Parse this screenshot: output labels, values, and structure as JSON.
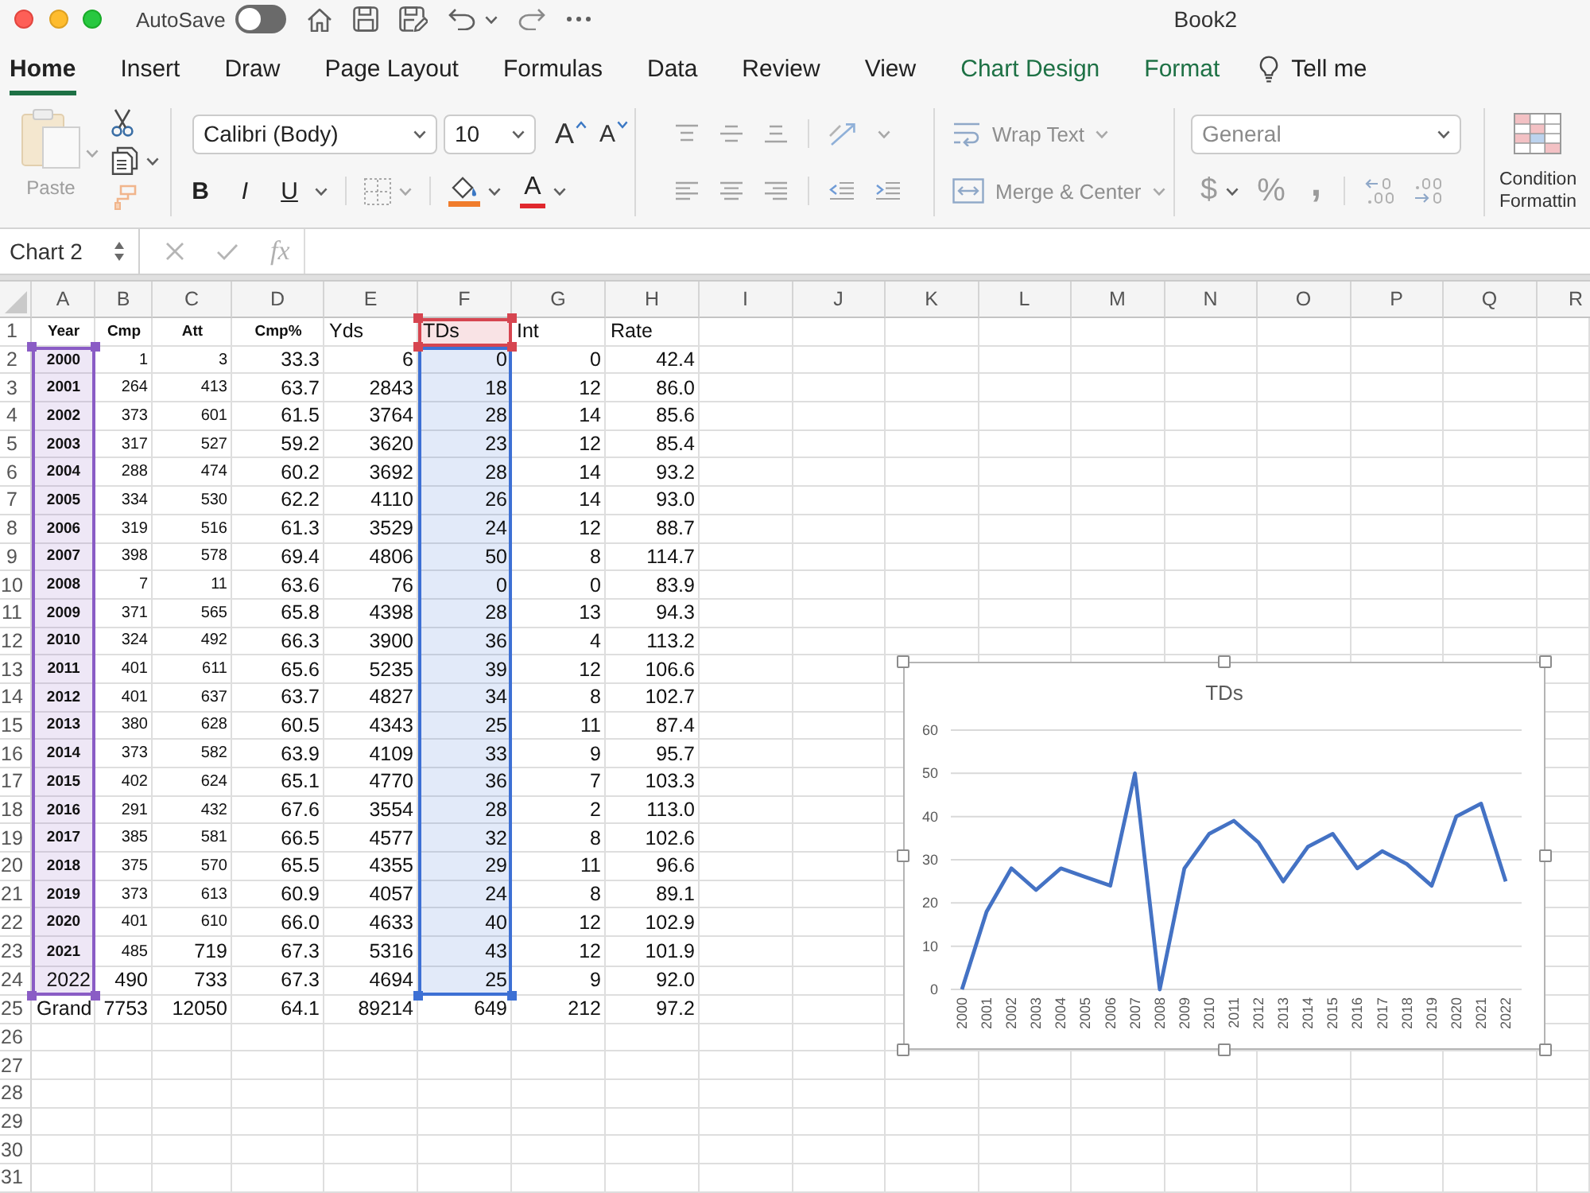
{
  "window": {
    "title": "Book2"
  },
  "title_bar": {
    "autosave": {
      "label": "AutoSave",
      "on": false
    }
  },
  "tabs": [
    {
      "label": "Home",
      "kind": "standard",
      "selected": true
    },
    {
      "label": "Insert",
      "kind": "standard",
      "selected": false
    },
    {
      "label": "Draw",
      "kind": "standard",
      "selected": false
    },
    {
      "label": "Page Layout",
      "kind": "standard",
      "selected": false
    },
    {
      "label": "Formulas",
      "kind": "standard",
      "selected": false
    },
    {
      "label": "Data",
      "kind": "standard",
      "selected": false
    },
    {
      "label": "Review",
      "kind": "standard",
      "selected": false
    },
    {
      "label": "View",
      "kind": "standard",
      "selected": false
    },
    {
      "label": "Chart Design",
      "kind": "contextual",
      "selected": false
    },
    {
      "label": "Format",
      "kind": "contextual",
      "selected": false
    }
  ],
  "tell_me": {
    "label": "Tell me"
  },
  "ribbon": {
    "paste": {
      "label": "Paste",
      "disabled": true
    },
    "font_name": {
      "value": "Calibri (Body)"
    },
    "font_size": {
      "value": "10"
    },
    "size_buttons": [
      {
        "label": "A",
        "kind": "grow"
      },
      {
        "label": "A",
        "kind": "shrink"
      }
    ],
    "style_buttons": [
      {
        "label": "B",
        "kind": "bold"
      },
      {
        "label": "I",
        "kind": "italic"
      },
      {
        "label": "U",
        "kind": "underline"
      }
    ],
    "font_color": {
      "label": "A"
    },
    "wrap_text": {
      "label": "Wrap Text",
      "disabled": true
    },
    "merge_center": {
      "label": "Merge & Center",
      "disabled": true
    },
    "number_format": {
      "value": "General",
      "disabled": true
    },
    "number_buttons": [
      {
        "label": "$",
        "kind": "currency",
        "disabled": true
      },
      {
        "label": "%",
        "kind": "percent",
        "disabled": true
      },
      {
        "label": ",",
        "kind": "comma",
        "disabled": true
      }
    ],
    "conditional_formatting": {
      "lines": [
        "Condition",
        "Formattin"
      ]
    }
  },
  "formula_bar": {
    "name_box": "Chart 2",
    "function_label": "fx"
  },
  "sheet": {
    "columns": [
      "A",
      "B",
      "C",
      "D",
      "E",
      "F",
      "G",
      "H",
      "I",
      "J",
      "K",
      "L",
      "M",
      "N",
      "O",
      "P",
      "Q",
      "R"
    ],
    "rows": [
      {
        "number": "1",
        "kind": "heading",
        "cells": [
          {
            "text": "Year"
          },
          {
            "text": "Cmp"
          },
          {
            "text": "Att"
          },
          {
            "text": "Cmp%"
          },
          {
            "text": "Yds"
          },
          {
            "text": "TDs",
            "color": "#d64550"
          },
          {
            "text": "Int"
          },
          {
            "text": "Rate"
          }
        ]
      },
      {
        "number": "2",
        "kind": "pasted",
        "cells": [
          {
            "text": "2000",
            "color": "#8a5cc5"
          },
          {
            "text": "1"
          },
          {
            "text": "3"
          },
          {
            "text": "33.3"
          },
          {
            "text": "6"
          },
          {
            "text": "0",
            "color": "#3d70d4"
          },
          {
            "text": "0"
          },
          {
            "text": "42.4"
          }
        ]
      },
      {
        "number": "3",
        "kind": "pasted",
        "cells": [
          {
            "text": "2001",
            "color": "#8a5cc5"
          },
          {
            "text": "264"
          },
          {
            "text": "413"
          },
          {
            "text": "63.7"
          },
          {
            "text": "2843"
          },
          {
            "text": "18",
            "color": "#3d70d4"
          },
          {
            "text": "12"
          },
          {
            "text": "86.0"
          }
        ]
      },
      {
        "number": "4",
        "kind": "pasted",
        "cells": [
          {
            "text": "2002",
            "color": "#8a5cc5"
          },
          {
            "text": "373"
          },
          {
            "text": "601"
          },
          {
            "text": "61.5"
          },
          {
            "text": "3764"
          },
          {
            "text": "28",
            "color": "#3d70d4"
          },
          {
            "text": "14"
          },
          {
            "text": "85.6"
          }
        ]
      },
      {
        "number": "5",
        "kind": "pasted",
        "cells": [
          {
            "text": "2003",
            "color": "#8a5cc5"
          },
          {
            "text": "317"
          },
          {
            "text": "527"
          },
          {
            "text": "59.2"
          },
          {
            "text": "3620"
          },
          {
            "text": "23",
            "color": "#3d70d4"
          },
          {
            "text": "12"
          },
          {
            "text": "85.4"
          }
        ]
      },
      {
        "number": "6",
        "kind": "pasted",
        "cells": [
          {
            "text": "2004",
            "color": "#8a5cc5"
          },
          {
            "text": "288"
          },
          {
            "text": "474"
          },
          {
            "text": "60.2"
          },
          {
            "text": "3692"
          },
          {
            "text": "28",
            "color": "#3d70d4"
          },
          {
            "text": "14"
          },
          {
            "text": "93.2"
          }
        ]
      },
      {
        "number": "7",
        "kind": "pasted",
        "cells": [
          {
            "text": "2005",
            "color": "#8a5cc5"
          },
          {
            "text": "334"
          },
          {
            "text": "530"
          },
          {
            "text": "62.2"
          },
          {
            "text": "4110"
          },
          {
            "text": "26",
            "color": "#3d70d4"
          },
          {
            "text": "14"
          },
          {
            "text": "93.0"
          }
        ]
      },
      {
        "number": "8",
        "kind": "pasted",
        "cells": [
          {
            "text": "2006",
            "color": "#8a5cc5"
          },
          {
            "text": "319"
          },
          {
            "text": "516"
          },
          {
            "text": "61.3"
          },
          {
            "text": "3529"
          },
          {
            "text": "24",
            "color": "#3d70d4"
          },
          {
            "text": "12"
          },
          {
            "text": "88.7"
          }
        ]
      },
      {
        "number": "9",
        "kind": "pasted",
        "cells": [
          {
            "text": "2007",
            "color": "#8a5cc5"
          },
          {
            "text": "398"
          },
          {
            "text": "578"
          },
          {
            "text": "69.4"
          },
          {
            "text": "4806"
          },
          {
            "text": "50",
            "color": "#3d70d4"
          },
          {
            "text": "8"
          },
          {
            "text": "114.7"
          }
        ]
      },
      {
        "number": "10",
        "kind": "pasted",
        "cells": [
          {
            "text": "2008",
            "color": "#8a5cc5"
          },
          {
            "text": "7"
          },
          {
            "text": "11"
          },
          {
            "text": "63.6"
          },
          {
            "text": "76"
          },
          {
            "text": "0",
            "color": "#3d70d4"
          },
          {
            "text": "0"
          },
          {
            "text": "83.9"
          }
        ]
      },
      {
        "number": "11",
        "kind": "pasted",
        "cells": [
          {
            "text": "2009",
            "color": "#8a5cc5"
          },
          {
            "text": "371"
          },
          {
            "text": "565"
          },
          {
            "text": "65.8"
          },
          {
            "text": "4398"
          },
          {
            "text": "28",
            "color": "#3d70d4"
          },
          {
            "text": "13"
          },
          {
            "text": "94.3"
          }
        ]
      },
      {
        "number": "12",
        "kind": "pasted",
        "cells": [
          {
            "text": "2010",
            "color": "#8a5cc5"
          },
          {
            "text": "324"
          },
          {
            "text": "492"
          },
          {
            "text": "66.3"
          },
          {
            "text": "3900"
          },
          {
            "text": "36",
            "color": "#3d70d4"
          },
          {
            "text": "4"
          },
          {
            "text": "113.2"
          }
        ]
      },
      {
        "number": "13",
        "kind": "pasted",
        "cells": [
          {
            "text": "2011",
            "color": "#8a5cc5"
          },
          {
            "text": "401"
          },
          {
            "text": "611"
          },
          {
            "text": "65.6"
          },
          {
            "text": "5235"
          },
          {
            "text": "39",
            "color": "#3d70d4"
          },
          {
            "text": "12"
          },
          {
            "text": "106.6"
          }
        ]
      },
      {
        "number": "14",
        "kind": "pasted",
        "cells": [
          {
            "text": "2012",
            "color": "#8a5cc5"
          },
          {
            "text": "401"
          },
          {
            "text": "637"
          },
          {
            "text": "63.7"
          },
          {
            "text": "4827"
          },
          {
            "text": "34",
            "color": "#3d70d4"
          },
          {
            "text": "8"
          },
          {
            "text": "102.7"
          }
        ]
      },
      {
        "number": "15",
        "kind": "pasted",
        "cells": [
          {
            "text": "2013",
            "color": "#8a5cc5"
          },
          {
            "text": "380"
          },
          {
            "text": "628"
          },
          {
            "text": "60.5"
          },
          {
            "text": "4343"
          },
          {
            "text": "25",
            "color": "#3d70d4"
          },
          {
            "text": "11"
          },
          {
            "text": "87.4"
          }
        ]
      },
      {
        "number": "16",
        "kind": "pasted",
        "cells": [
          {
            "text": "2014",
            "color": "#8a5cc5"
          },
          {
            "text": "373"
          },
          {
            "text": "582"
          },
          {
            "text": "63.9"
          },
          {
            "text": "4109"
          },
          {
            "text": "33",
            "color": "#3d70d4"
          },
          {
            "text": "9"
          },
          {
            "text": "95.7"
          }
        ]
      },
      {
        "number": "17",
        "kind": "pasted",
        "cells": [
          {
            "text": "2015",
            "color": "#8a5cc5"
          },
          {
            "text": "402"
          },
          {
            "text": "624"
          },
          {
            "text": "65.1"
          },
          {
            "text": "4770"
          },
          {
            "text": "36",
            "color": "#3d70d4"
          },
          {
            "text": "7"
          },
          {
            "text": "103.3"
          }
        ]
      },
      {
        "number": "18",
        "kind": "pasted",
        "cells": [
          {
            "text": "2016",
            "color": "#8a5cc5"
          },
          {
            "text": "291"
          },
          {
            "text": "432"
          },
          {
            "text": "67.6"
          },
          {
            "text": "3554"
          },
          {
            "text": "28",
            "color": "#3d70d4"
          },
          {
            "text": "2"
          },
          {
            "text": "113.0"
          }
        ]
      },
      {
        "number": "19",
        "kind": "pasted",
        "cells": [
          {
            "text": "2017",
            "color": "#8a5cc5"
          },
          {
            "text": "385"
          },
          {
            "text": "581"
          },
          {
            "text": "66.5"
          },
          {
            "text": "4577"
          },
          {
            "text": "32",
            "color": "#3d70d4"
          },
          {
            "text": "8"
          },
          {
            "text": "102.6"
          }
        ]
      },
      {
        "number": "20",
        "kind": "pasted",
        "cells": [
          {
            "text": "2018",
            "color": "#8a5cc5"
          },
          {
            "text": "375"
          },
          {
            "text": "570"
          },
          {
            "text": "65.5"
          },
          {
            "text": "4355"
          },
          {
            "text": "29",
            "color": "#3d70d4"
          },
          {
            "text": "11"
          },
          {
            "text": "96.6"
          }
        ]
      },
      {
        "number": "21",
        "kind": "pasted",
        "cells": [
          {
            "text": "2019",
            "color": "#8a5cc5"
          },
          {
            "text": "373"
          },
          {
            "text": "613"
          },
          {
            "text": "60.9"
          },
          {
            "text": "4057"
          },
          {
            "text": "24",
            "color": "#3d70d4"
          },
          {
            "text": "8"
          },
          {
            "text": "89.1"
          }
        ]
      },
      {
        "number": "22",
        "kind": "pasted",
        "cells": [
          {
            "text": "2020",
            "color": "#8a5cc5"
          },
          {
            "text": "401"
          },
          {
            "text": "610"
          },
          {
            "text": "66.0"
          },
          {
            "text": "4633"
          },
          {
            "text": "40",
            "color": "#3d70d4"
          },
          {
            "text": "12"
          },
          {
            "text": "102.9"
          }
        ]
      },
      {
        "number": "23",
        "kind": "mixed",
        "cells": [
          {
            "text": "2021",
            "color": "#8a5cc5"
          },
          {
            "text": "485"
          },
          {
            "text": "719"
          },
          {
            "text": "67.3"
          },
          {
            "text": "5316"
          },
          {
            "text": "43",
            "color": "#3d70d4"
          },
          {
            "text": "12"
          },
          {
            "text": "101.9"
          }
        ]
      },
      {
        "number": "24",
        "kind": "plain",
        "cells": [
          {
            "text": "2022",
            "color": "#8a5cc5"
          },
          {
            "text": "490"
          },
          {
            "text": "733"
          },
          {
            "text": "67.3"
          },
          {
            "text": "4694"
          },
          {
            "text": "25",
            "color": "#3d70d4"
          },
          {
            "text": "9"
          },
          {
            "text": "92.0"
          }
        ]
      },
      {
        "number": "25",
        "kind": "total",
        "cells": [
          {
            "text": "Grand"
          },
          {
            "text": "7753"
          },
          {
            "text": "12050"
          },
          {
            "text": "64.1"
          },
          {
            "text": "89214"
          },
          {
            "text": "649"
          },
          {
            "text": "212"
          },
          {
            "text": "97.2"
          }
        ]
      },
      {
        "number": "26",
        "kind": "blank"
      },
      {
        "number": "27",
        "kind": "blank"
      },
      {
        "number": "28",
        "kind": "blank"
      },
      {
        "number": "29",
        "kind": "blank"
      },
      {
        "number": "30",
        "kind": "blank"
      },
      {
        "number": "31",
        "kind": "blank"
      }
    ]
  },
  "chart": {
    "chart_data": {
      "type": "line",
      "title": "TDs",
      "categories": [
        "2000",
        "2001",
        "2002",
        "2003",
        "2004",
        "2005",
        "2006",
        "2007",
        "2008",
        "2009",
        "2010",
        "2011",
        "2012",
        "2013",
        "2014",
        "2015",
        "2016",
        "2017",
        "2018",
        "2019",
        "2020",
        "2021",
        "2022"
      ],
      "series": [
        {
          "color": "#4472c4",
          "values": [
            0,
            18,
            28,
            23,
            28,
            26,
            24,
            50,
            0,
            28,
            36,
            39,
            34,
            25,
            33,
            36,
            28,
            32,
            29,
            24,
            40,
            43,
            25
          ]
        }
      ],
      "ylim": [
        0,
        60
      ],
      "yticks": [
        0,
        10,
        20,
        30,
        40,
        50,
        60
      ],
      "grid": true
    }
  }
}
